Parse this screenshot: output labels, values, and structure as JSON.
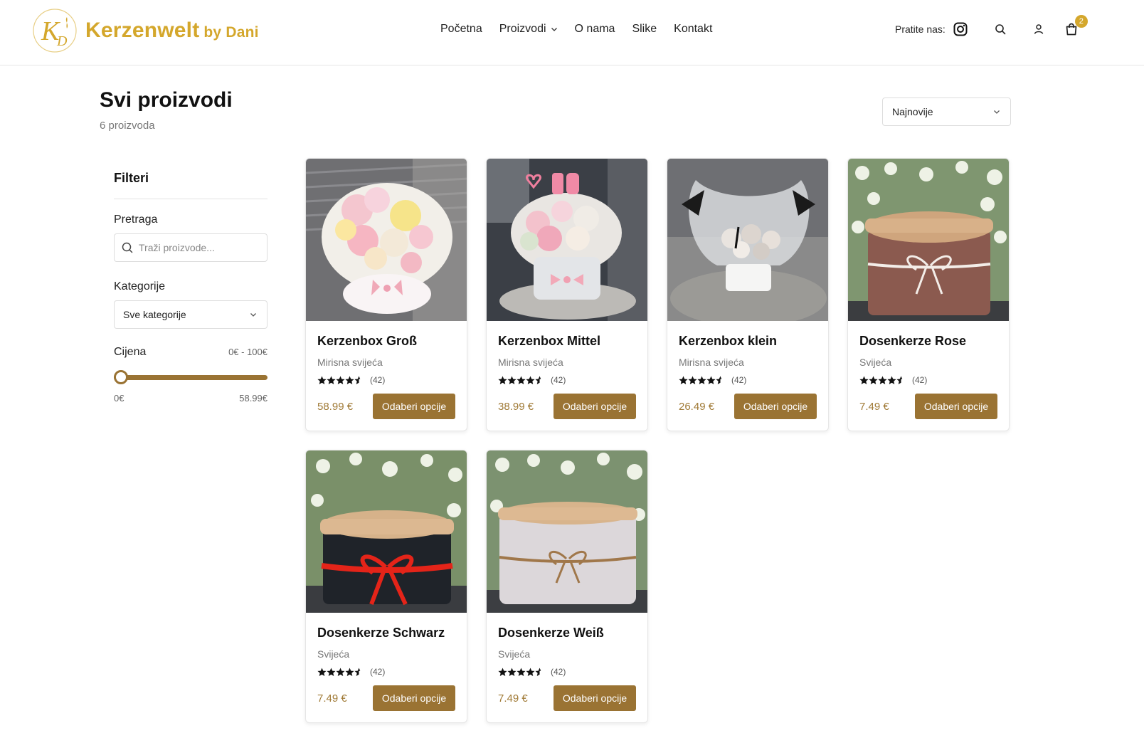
{
  "brand": {
    "name": "Kerzenwelt",
    "sub": "by Dani",
    "color": "#d4a72c"
  },
  "nav": {
    "items": [
      "Početna",
      "Proizvodi",
      "O nama",
      "Slike",
      "Kontakt"
    ]
  },
  "header": {
    "follow_label": "Pratite nas:",
    "cart_count": "2",
    "icons": [
      "instagram-icon",
      "search-icon",
      "user-icon",
      "cart-icon"
    ]
  },
  "page": {
    "title": "Svi proizvodi",
    "count": "6 proizvoda"
  },
  "sort": {
    "selected": "Najnovije"
  },
  "filters": {
    "title": "Filteri",
    "search_label": "Pretraga",
    "search_placeholder": "Traži proizvode...",
    "category_label": "Kategorije",
    "category_selected": "Sve kategorije",
    "price_label": "Cijena",
    "price_range": "0€ - 100€",
    "price_min_value": "0€",
    "price_max_value": "58.99€"
  },
  "products": [
    {
      "name": "Kerzenbox Groß",
      "category": "Mirisna svijeća",
      "reviews": "(42)",
      "price": "58.99 €",
      "button": "Odaberi opcije",
      "image": "flower-box-large"
    },
    {
      "name": "Kerzenbox Mittel",
      "category": "Mirisna svijeća",
      "reviews": "(42)",
      "price": "38.99 €",
      "button": "Odaberi opcije",
      "image": "flower-box-medium"
    },
    {
      "name": "Kerzenbox klein",
      "category": "Mirisna svijeća",
      "reviews": "(42)",
      "price": "26.49 €",
      "button": "Odaberi opcije",
      "image": "flower-box-small"
    },
    {
      "name": "Dosenkerze Rose",
      "category": "Svijeća",
      "reviews": "(42)",
      "price": "7.49 €",
      "button": "Odaberi opcije",
      "image": "tin-candle-rose"
    },
    {
      "name": "Dosenkerze Schwarz",
      "category": "Svijeća",
      "reviews": "(42)",
      "price": "7.49 €",
      "button": "Odaberi opcije",
      "image": "tin-candle-black"
    },
    {
      "name": "Dosenkerze Weiß",
      "category": "Svijeća",
      "reviews": "(42)",
      "price": "7.49 €",
      "button": "Odaberi opcije",
      "image": "tin-candle-white"
    }
  ],
  "colors": {
    "accent": "#9a7333",
    "price": "#a07a36",
    "logo": "#d4a72c"
  }
}
